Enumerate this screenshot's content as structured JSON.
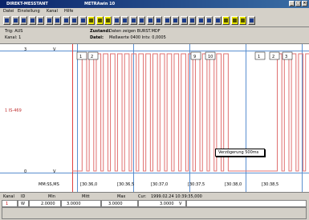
{
  "window": {
    "app_label": "DIREKT-MESSTANT",
    "doc_title": "METRAwin 10",
    "minimize_glyph": "_",
    "maximize_glyph": "□",
    "close_glyph": "×"
  },
  "menu": [
    "Datei",
    "Einstellung",
    "Kanal",
    "Hilfe"
  ],
  "toolbar_count": 30,
  "info": {
    "trig": "Trig: AUS",
    "kanal": "Kanal: 1",
    "zustand": "Zustand:",
    "zustand_value": "Daten zeigen BURST.MDF",
    "datei": "Datei:",
    "datei_value": "Meßwerte 0400  Intv: 0,0005"
  },
  "chart_data": {
    "type": "line",
    "ylabel_unit": "V",
    "y_top_label": "3",
    "y_bottom_label": "0",
    "y_side_label": "1 IS-469",
    "x_tick_labels": [
      "MM:SS,MS",
      "[30:36,0",
      "[30:36,5",
      "[30:37,0",
      "[30:37,5",
      "[30:38,0",
      "[30:38,5"
    ],
    "markers": [
      "1",
      "2",
      "9",
      "10",
      "1",
      "2",
      "3"
    ],
    "annotation": "Verzögerung 500ms",
    "grid": true,
    "series": [
      {
        "color": "#e07070",
        "levels_low_high": [
          0,
          3
        ],
        "pulse_starts_sec": [
          0.05,
          0.12,
          0.19,
          0.26,
          0.33,
          0.4,
          0.47,
          0.54,
          0.61,
          0.68,
          0.75,
          0.82,
          0.89,
          0.96,
          1.03,
          1.1,
          1.17,
          1.24,
          1.31,
          1.38,
          1.45,
          1.98,
          2.05,
          2.12,
          2.19,
          2.26,
          2.33
        ],
        "pulse_width_sec": 0.045
      }
    ]
  },
  "status": {
    "headers": [
      "Kanal",
      "ID",
      "Min",
      "Mitt",
      "Max",
      "Cur:"
    ],
    "cursor_value": "1999.02.24 10:39:35,000",
    "row_channel": "1",
    "row_id": "W",
    "min": "2.0000",
    "mitt": "3.0000",
    "max": "3.0000",
    "cur": "3.0000",
    "cur_unit": "V"
  },
  "colors": {
    "titlebar": "#0a246a",
    "plot_bg": "#ffffff",
    "signal": "#e07070",
    "grid": "#5a8fd0"
  }
}
